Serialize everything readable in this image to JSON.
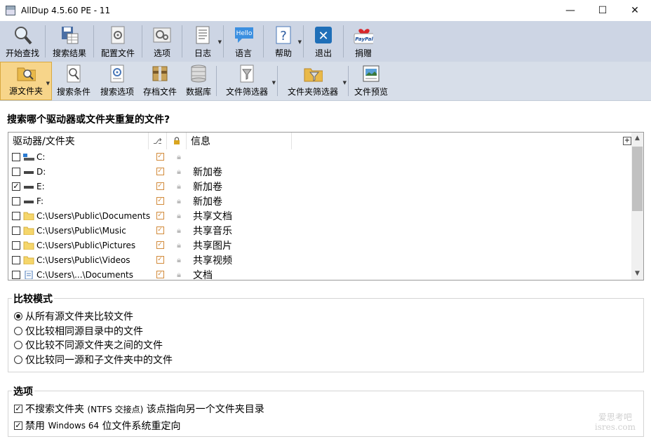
{
  "window": {
    "title": "AllDup 4.5.60 PE - 11",
    "minimize": "—",
    "maximize": "☐",
    "close": "✕"
  },
  "toolbar1": [
    {
      "label": "开始查找",
      "icon": "magnifier-icon"
    },
    {
      "label": "搜索结果",
      "icon": "floppy-table-icon"
    },
    {
      "label": "配置文件",
      "icon": "gear-file-icon"
    },
    {
      "label": "选项",
      "icon": "gears-icon"
    },
    {
      "label": "日志",
      "icon": "log-icon"
    },
    {
      "label": "语言",
      "icon": "hello-bubble-icon",
      "icon_text": "Hello"
    },
    {
      "label": "帮助",
      "icon": "help-icon",
      "icon_text": "?"
    },
    {
      "label": "退出",
      "icon": "exit-icon",
      "icon_text": "✕"
    },
    {
      "label": "捐赠",
      "icon": "paypal-icon",
      "icon_text": "PayPal"
    }
  ],
  "toolbar2": [
    {
      "label": "源文件夹",
      "icon": "folder-search-icon"
    },
    {
      "label": "搜索条件",
      "icon": "search-criteria-icon"
    },
    {
      "label": "搜索选项",
      "icon": "search-options-icon"
    },
    {
      "label": "存档文件",
      "icon": "archive-icon"
    },
    {
      "label": "数据库",
      "icon": "database-icon"
    },
    {
      "label": "文件筛选器",
      "icon": "file-filter-icon"
    },
    {
      "label": "文件夹筛选器",
      "icon": "folder-filter-icon"
    },
    {
      "label": "文件预览",
      "icon": "preview-icon"
    }
  ],
  "main": {
    "heading": "搜索哪个驱动器或文件夹重复的文件?",
    "columns": {
      "drive_folder": "驱动器/文件夹",
      "info": "信息",
      "expand": "+"
    },
    "rows": [
      {
        "path": "C:",
        "info": "",
        "checked": false,
        "icon": "system-drive-icon"
      },
      {
        "path": "D:",
        "info": "新加卷",
        "checked": false,
        "icon": "drive-icon"
      },
      {
        "path": "E:",
        "info": "新加卷",
        "checked": true,
        "icon": "drive-icon"
      },
      {
        "path": "F:",
        "info": "新加卷",
        "checked": false,
        "icon": "drive-icon"
      },
      {
        "path": "C:\\Users\\Public\\Documents",
        "info": "共享文档",
        "checked": false,
        "icon": "folder-icon"
      },
      {
        "path": "C:\\Users\\Public\\Music",
        "info": "共享音乐",
        "checked": false,
        "icon": "folder-icon"
      },
      {
        "path": "C:\\Users\\Public\\Pictures",
        "info": "共享图片",
        "checked": false,
        "icon": "folder-icon"
      },
      {
        "path": "C:\\Users\\Public\\Videos",
        "info": "共享视频",
        "checked": false,
        "icon": "folder-icon"
      },
      {
        "path": "C:\\Users\\...\\Documents",
        "info": "文档",
        "checked": false,
        "icon": "document-icon"
      }
    ]
  },
  "compare": {
    "title": "比较模式",
    "options": [
      {
        "label": "从所有源文件夹比较文件",
        "selected": true
      },
      {
        "label": "仅比较相同源目录中的文件",
        "selected": false
      },
      {
        "label": "仅比较不同源文件夹之间的文件",
        "selected": false
      },
      {
        "label": "仅比较同一源和子文件夹中的文件",
        "selected": false
      }
    ]
  },
  "options": {
    "title": "选项",
    "opt1_prefix": "不搜索文件夹",
    "opt1_small": "(NTFS 交接点)",
    "opt1_suffix": "该点指向另一个文件夹目录",
    "opt2_prefix": "禁用",
    "opt2_small": "Windows 64",
    "opt2_suffix": "位文件系统重定向"
  },
  "watermark": {
    "line1": "爱思考吧",
    "line2": "isres.com"
  }
}
